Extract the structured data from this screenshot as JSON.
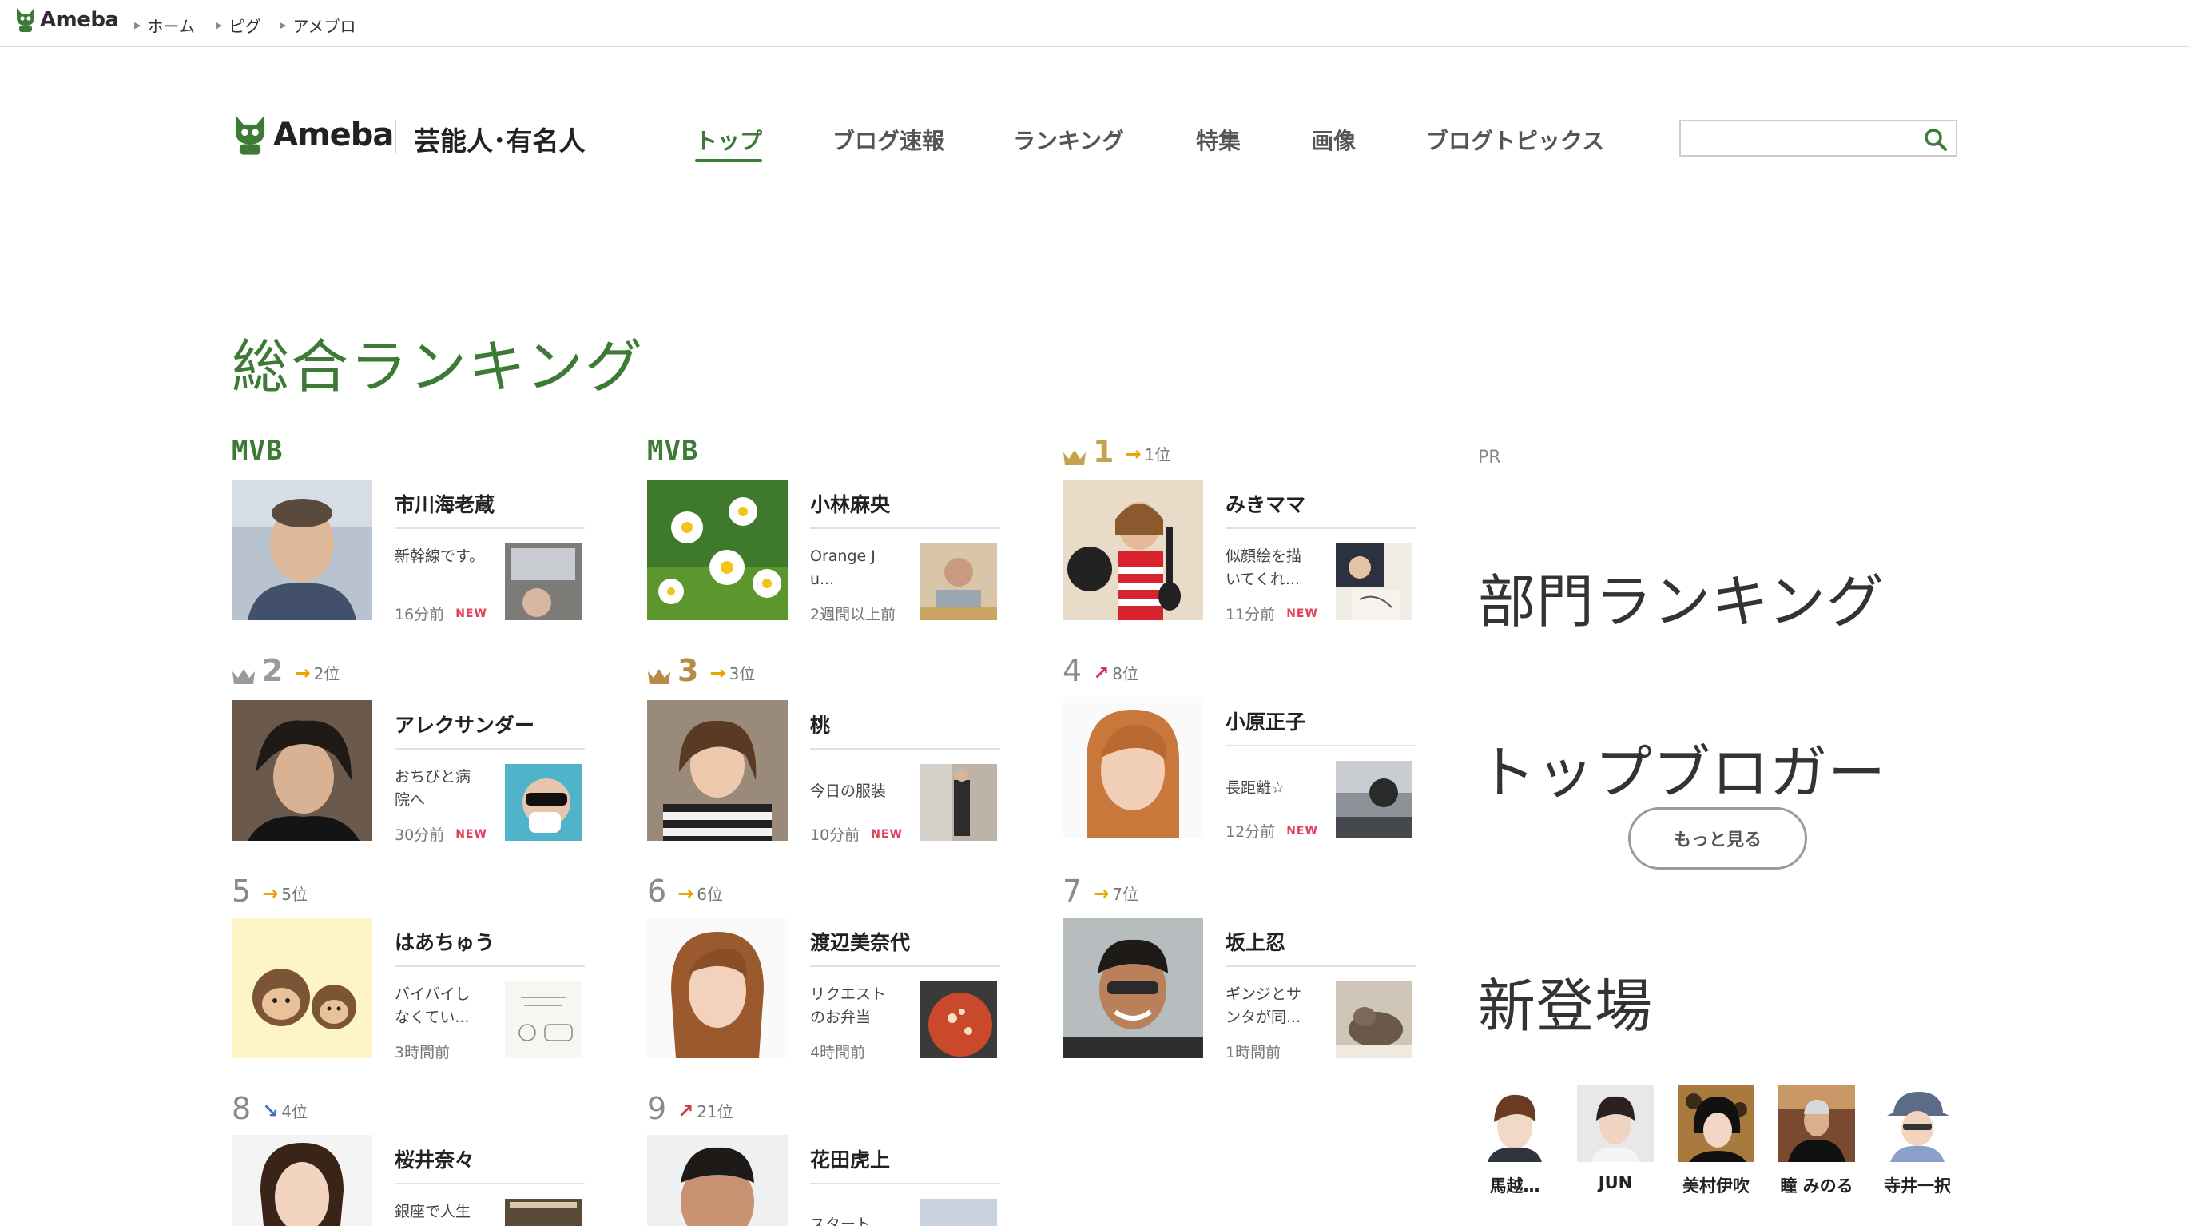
{
  "topbar": {
    "logo": "Ameba",
    "breadcrumbs": [
      "ホーム",
      "ピグ",
      "アメブロ"
    ]
  },
  "header": {
    "logo": "Ameba",
    "category": "芸能人･有名人",
    "nav": [
      "トップ",
      "ブログ速報",
      "ランキング",
      "特集",
      "画像",
      "ブログトピックス"
    ],
    "search_placeholder": ""
  },
  "section_title": "総合ランキング",
  "ranking": [
    {
      "badge": "MVB",
      "name": "市川海老蔵",
      "excerpt": "新幹線です。",
      "time": "16分前",
      "new": "NEW"
    },
    {
      "badge": "MVB",
      "name": "小林麻央",
      "excerpt": "Orange Ju...",
      "time": "2週間以上前",
      "new": ""
    },
    {
      "rank": "1",
      "prev": "1位",
      "trend": "flat",
      "name": "みきママ",
      "excerpt": "似顔絵を描いてくれ...",
      "time": "11分前",
      "new": "NEW"
    },
    {
      "rank": "2",
      "prev": "2位",
      "trend": "flat",
      "name": "アレクサンダー",
      "excerpt": "おちびと病院へ",
      "time": "30分前",
      "new": "NEW"
    },
    {
      "rank": "3",
      "prev": "3位",
      "trend": "flat",
      "name": "桃",
      "excerpt": "今日の服装",
      "time": "10分前",
      "new": "NEW"
    },
    {
      "rank": "4",
      "prev": "8位",
      "trend": "up",
      "name": "小原正子",
      "excerpt": "長距離☆",
      "time": "12分前",
      "new": "NEW"
    },
    {
      "rank": "5",
      "prev": "5位",
      "trend": "flat",
      "name": "はあちゅう",
      "excerpt": "バイバイしなくてい...",
      "time": "3時間前",
      "new": ""
    },
    {
      "rank": "6",
      "prev": "6位",
      "trend": "flat",
      "name": "渡辺美奈代",
      "excerpt": "リクエストのお弁当",
      "time": "4時間前",
      "new": ""
    },
    {
      "rank": "7",
      "prev": "7位",
      "trend": "flat",
      "name": "坂上忍",
      "excerpt": "ギンジとサンタが同...",
      "time": "1時間前",
      "new": ""
    },
    {
      "rank": "8",
      "prev": "4位",
      "trend": "down",
      "name": "桜井奈々",
      "excerpt": "銀座で人生",
      "time": "",
      "new": ""
    },
    {
      "rank": "9",
      "prev": "21位",
      "trend": "up",
      "name": "花田虎上",
      "excerpt": "スタート",
      "time": "",
      "new": ""
    }
  ],
  "sidebar": {
    "pr": "PR",
    "dept_ranking": "部門ランキング",
    "top_blogger": "トップブロガー",
    "more_button": "もっと見る",
    "new_arrivals": "新登場",
    "newcomers": [
      "馬越…",
      "JUN",
      "美村伊吹",
      "瞳 みのる",
      "寺井一択"
    ]
  },
  "colors": {
    "brand_green": "#3d7a35",
    "new_badge": "#e2415c",
    "gold": "#c5a24e",
    "arrow_flat": "#e5a300",
    "arrow_up": "#d3374a",
    "arrow_down": "#3a72c4"
  }
}
